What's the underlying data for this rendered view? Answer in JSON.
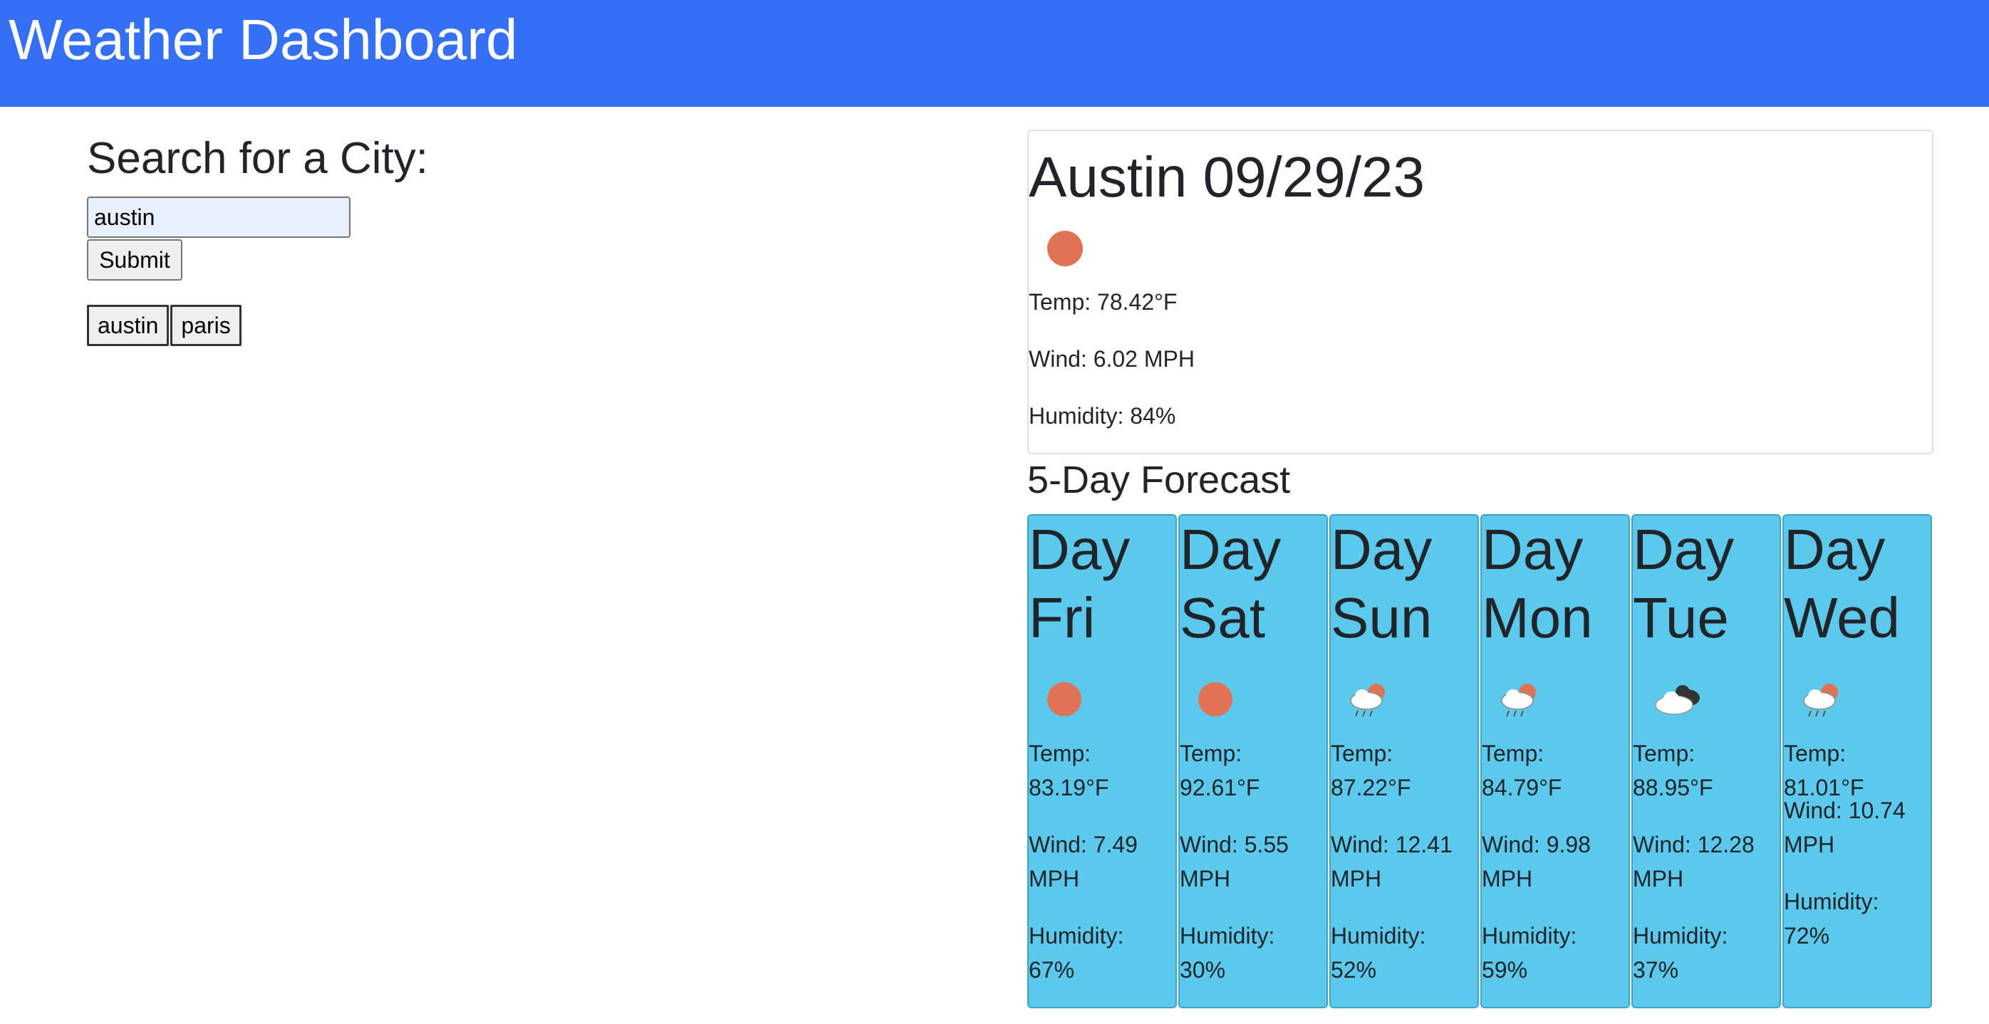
{
  "header": {
    "title": "Weather Dashboard"
  },
  "search": {
    "heading": "Search for a City:",
    "input_value": "austin",
    "submit_label": "Submit",
    "history": [
      "austin",
      "paris"
    ]
  },
  "current": {
    "title": "Austin 09/29/23",
    "icon": "sun-icon",
    "temp": "Temp: 78.42°F",
    "wind": "Wind: 6.02 MPH",
    "humidity": "Humidity: 84%"
  },
  "forecast": {
    "heading": "5-Day Forecast",
    "days": [
      {
        "title": "Day Fri",
        "icon": "sun-icon",
        "temp": "Temp: 83.19°F",
        "wind": "Wind: 7.49 MPH",
        "humidity": "Humidity: 67%"
      },
      {
        "title": "Day Sat",
        "icon": "sun-icon",
        "temp": "Temp: 92.61°F",
        "wind": "Wind: 5.55 MPH",
        "humidity": "Humidity: 30%"
      },
      {
        "title": "Day Sun",
        "icon": "rain-sun-icon",
        "temp": "Temp: 87.22°F",
        "wind": "Wind: 12.41 MPH",
        "humidity": "Humidity: 52%"
      },
      {
        "title": "Day Mon",
        "icon": "rain-sun-icon",
        "temp": "Temp: 84.79°F",
        "wind": "Wind: 9.98 MPH",
        "humidity": "Humidity: 59%"
      },
      {
        "title": "Day Tue",
        "icon": "broken-clouds-icon",
        "temp": "Temp: 88.95°F",
        "wind": "Wind: 12.28 MPH",
        "humidity": "Humidity: 37%"
      },
      {
        "title": "Day Wed",
        "icon": "rain-sun-icon",
        "temp": "Temp: 81.01°F",
        "wind": "Wind: 10.74 MPH",
        "humidity": "Humidity: 72%"
      }
    ]
  },
  "colors": {
    "header_bg": "#346ff6",
    "card_bg": "#5bc8ec",
    "sun": "#e07356"
  }
}
